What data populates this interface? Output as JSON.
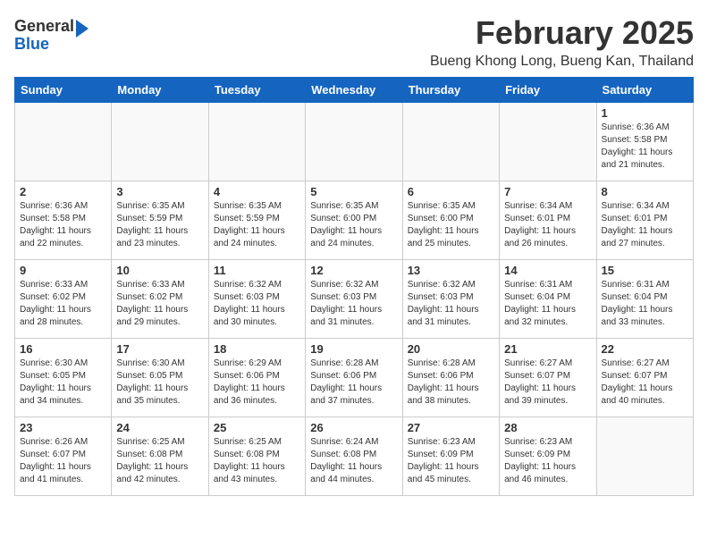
{
  "header": {
    "logo_general": "General",
    "logo_blue": "Blue",
    "month": "February 2025",
    "location": "Bueng Khong Long, Bueng Kan, Thailand"
  },
  "weekdays": [
    "Sunday",
    "Monday",
    "Tuesday",
    "Wednesday",
    "Thursday",
    "Friday",
    "Saturday"
  ],
  "weeks": [
    [
      {
        "day": "",
        "info": ""
      },
      {
        "day": "",
        "info": ""
      },
      {
        "day": "",
        "info": ""
      },
      {
        "day": "",
        "info": ""
      },
      {
        "day": "",
        "info": ""
      },
      {
        "day": "",
        "info": ""
      },
      {
        "day": "1",
        "info": "Sunrise: 6:36 AM\nSunset: 5:58 PM\nDaylight: 11 hours and 21 minutes."
      }
    ],
    [
      {
        "day": "2",
        "info": "Sunrise: 6:36 AM\nSunset: 5:58 PM\nDaylight: 11 hours and 22 minutes."
      },
      {
        "day": "3",
        "info": "Sunrise: 6:35 AM\nSunset: 5:59 PM\nDaylight: 11 hours and 23 minutes."
      },
      {
        "day": "4",
        "info": "Sunrise: 6:35 AM\nSunset: 5:59 PM\nDaylight: 11 hours and 24 minutes."
      },
      {
        "day": "5",
        "info": "Sunrise: 6:35 AM\nSunset: 6:00 PM\nDaylight: 11 hours and 24 minutes."
      },
      {
        "day": "6",
        "info": "Sunrise: 6:35 AM\nSunset: 6:00 PM\nDaylight: 11 hours and 25 minutes."
      },
      {
        "day": "7",
        "info": "Sunrise: 6:34 AM\nSunset: 6:01 PM\nDaylight: 11 hours and 26 minutes."
      },
      {
        "day": "8",
        "info": "Sunrise: 6:34 AM\nSunset: 6:01 PM\nDaylight: 11 hours and 27 minutes."
      }
    ],
    [
      {
        "day": "9",
        "info": "Sunrise: 6:33 AM\nSunset: 6:02 PM\nDaylight: 11 hours and 28 minutes."
      },
      {
        "day": "10",
        "info": "Sunrise: 6:33 AM\nSunset: 6:02 PM\nDaylight: 11 hours and 29 minutes."
      },
      {
        "day": "11",
        "info": "Sunrise: 6:32 AM\nSunset: 6:03 PM\nDaylight: 11 hours and 30 minutes."
      },
      {
        "day": "12",
        "info": "Sunrise: 6:32 AM\nSunset: 6:03 PM\nDaylight: 11 hours and 31 minutes."
      },
      {
        "day": "13",
        "info": "Sunrise: 6:32 AM\nSunset: 6:03 PM\nDaylight: 11 hours and 31 minutes."
      },
      {
        "day": "14",
        "info": "Sunrise: 6:31 AM\nSunset: 6:04 PM\nDaylight: 11 hours and 32 minutes."
      },
      {
        "day": "15",
        "info": "Sunrise: 6:31 AM\nSunset: 6:04 PM\nDaylight: 11 hours and 33 minutes."
      }
    ],
    [
      {
        "day": "16",
        "info": "Sunrise: 6:30 AM\nSunset: 6:05 PM\nDaylight: 11 hours and 34 minutes."
      },
      {
        "day": "17",
        "info": "Sunrise: 6:30 AM\nSunset: 6:05 PM\nDaylight: 11 hours and 35 minutes."
      },
      {
        "day": "18",
        "info": "Sunrise: 6:29 AM\nSunset: 6:06 PM\nDaylight: 11 hours and 36 minutes."
      },
      {
        "day": "19",
        "info": "Sunrise: 6:28 AM\nSunset: 6:06 PM\nDaylight: 11 hours and 37 minutes."
      },
      {
        "day": "20",
        "info": "Sunrise: 6:28 AM\nSunset: 6:06 PM\nDaylight: 11 hours and 38 minutes."
      },
      {
        "day": "21",
        "info": "Sunrise: 6:27 AM\nSunset: 6:07 PM\nDaylight: 11 hours and 39 minutes."
      },
      {
        "day": "22",
        "info": "Sunrise: 6:27 AM\nSunset: 6:07 PM\nDaylight: 11 hours and 40 minutes."
      }
    ],
    [
      {
        "day": "23",
        "info": "Sunrise: 6:26 AM\nSunset: 6:07 PM\nDaylight: 11 hours and 41 minutes."
      },
      {
        "day": "24",
        "info": "Sunrise: 6:25 AM\nSunset: 6:08 PM\nDaylight: 11 hours and 42 minutes."
      },
      {
        "day": "25",
        "info": "Sunrise: 6:25 AM\nSunset: 6:08 PM\nDaylight: 11 hours and 43 minutes."
      },
      {
        "day": "26",
        "info": "Sunrise: 6:24 AM\nSunset: 6:08 PM\nDaylight: 11 hours and 44 minutes."
      },
      {
        "day": "27",
        "info": "Sunrise: 6:23 AM\nSunset: 6:09 PM\nDaylight: 11 hours and 45 minutes."
      },
      {
        "day": "28",
        "info": "Sunrise: 6:23 AM\nSunset: 6:09 PM\nDaylight: 11 hours and 46 minutes."
      },
      {
        "day": "",
        "info": ""
      }
    ]
  ]
}
